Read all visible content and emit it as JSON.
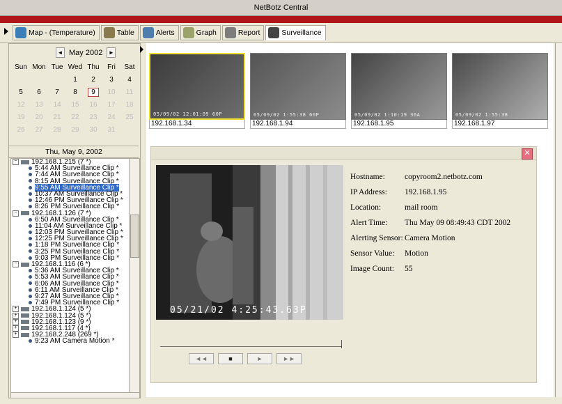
{
  "window": {
    "title": "NetBotz Central"
  },
  "tabs": [
    {
      "label": "Map - (Temperature)",
      "icon": "globe-icon",
      "color": "#3c7fb8",
      "active": false
    },
    {
      "label": "Table",
      "icon": "table-icon",
      "color": "#8a7a50",
      "active": false
    },
    {
      "label": "Alerts",
      "icon": "alert-icon",
      "color": "#4f7dae",
      "active": false
    },
    {
      "label": "Graph",
      "icon": "graph-icon",
      "color": "#9aa36a",
      "active": false
    },
    {
      "label": "Report",
      "icon": "report-icon",
      "color": "#7d7d7d",
      "active": false
    },
    {
      "label": "Surveillance",
      "icon": "camera-icon",
      "color": "#444444",
      "active": true
    }
  ],
  "calendar": {
    "prev": "◄",
    "month": "May",
    "year": "2002",
    "next": "►",
    "days": [
      "Sun",
      "Mon",
      "Tue",
      "Wed",
      "Thu",
      "Fri",
      "Sat"
    ],
    "weeks": [
      [
        "",
        "",
        "",
        "1",
        "2",
        "3",
        "4"
      ],
      [
        "5",
        "6",
        "7",
        "8",
        "9",
        "10",
        "11"
      ],
      [
        "12",
        "13",
        "14",
        "15",
        "16",
        "17",
        "18"
      ],
      [
        "19",
        "20",
        "21",
        "22",
        "23",
        "24",
        "25"
      ],
      [
        "26",
        "27",
        "28",
        "29",
        "30",
        "31",
        ""
      ]
    ],
    "selected_date": "Thu, May 9, 2002"
  },
  "tree": [
    {
      "type": "group",
      "label": "192.168.1.215 (7 *)"
    },
    {
      "type": "clip",
      "label": "5:44 AM Surveillance Clip *"
    },
    {
      "type": "clip",
      "label": "7:44 AM Surveillance Clip *"
    },
    {
      "type": "clip",
      "label": "8:15 AM Surveillance Clip *"
    },
    {
      "type": "clip",
      "label": "9:55 AM Surveillance Clip *",
      "selected": true
    },
    {
      "type": "clip",
      "label": "10:37 AM Surveillance Clip *"
    },
    {
      "type": "clip",
      "label": "12:46 PM Surveillance Clip *"
    },
    {
      "type": "clip",
      "label": "8:26 PM Surveillance Clip *"
    },
    {
      "type": "group",
      "label": "192.168.1.126 (7 *)"
    },
    {
      "type": "clip",
      "label": "6:50 AM Surveillance Clip *"
    },
    {
      "type": "clip",
      "label": "11:04 AM Surveillance Clip *"
    },
    {
      "type": "clip",
      "label": "12:03 PM Surveillance Clip *"
    },
    {
      "type": "clip",
      "label": "12:25 PM Surveillance Clip *"
    },
    {
      "type": "clip",
      "label": "1:18 PM Surveillance Clip *"
    },
    {
      "type": "clip",
      "label": "3:25 PM Surveillance Clip *"
    },
    {
      "type": "clip",
      "label": "9:03 PM Surveillance Clip *"
    },
    {
      "type": "group",
      "label": "192.168.1.116 (6 *)"
    },
    {
      "type": "clip",
      "label": "5:36 AM Surveillance Clip *"
    },
    {
      "type": "clip",
      "label": "5:53 AM Surveillance Clip *"
    },
    {
      "type": "clip",
      "label": "6:06 AM Surveillance Clip *"
    },
    {
      "type": "clip",
      "label": "6:11 AM Surveillance Clip *"
    },
    {
      "type": "clip",
      "label": "9:27 AM Surveillance Clip *"
    },
    {
      "type": "clip",
      "label": "7:49 PM Surveillance Clip *"
    },
    {
      "type": "group",
      "label": "192.168.1.124 (5 *)",
      "collapsed": true
    },
    {
      "type": "group",
      "label": "192.168.1.124 (5 *)",
      "collapsed": true
    },
    {
      "type": "group",
      "label": "192.168.1.123 (9 *)",
      "collapsed": true
    },
    {
      "type": "group",
      "label": "192.168.1.117 (4 *)",
      "collapsed": true
    },
    {
      "type": "group",
      "label": "192.168.2.248 (269 *)",
      "collapsed": true
    },
    {
      "type": "clip",
      "label": "9:23 AM Camera Motion *"
    }
  ],
  "thumbnails": [
    {
      "label": "192.168.1.34",
      "stamp": "05/09/02 12:01:09 60P",
      "active": true
    },
    {
      "label": "192.168.1.94",
      "stamp": "05/09/02 1:55:38 60P",
      "active": false
    },
    {
      "label": "192.168.1.95",
      "stamp": "05/09/02 1:10:19 36A",
      "active": false
    },
    {
      "label": "192.168.1.97",
      "stamp": "05/09/02 1:55:38",
      "active": false
    }
  ],
  "detail": {
    "close": "✕",
    "video_stamp": "05/21/02 4:25:43.63P",
    "fields": [
      {
        "key": "Hostname:",
        "value": "copyroom2.netbotz.com"
      },
      {
        "key": "IP Address:",
        "value": "192.168.1.95"
      },
      {
        "key": "Location:",
        "value": "mail room"
      },
      {
        "key": "Alert Time:",
        "value": "Thu May 09 08:49:43 CDT 2002"
      },
      {
        "key": "Alerting Sensor:",
        "value": "Camera Motion"
      },
      {
        "key": "Sensor Value:",
        "value": "Motion"
      },
      {
        "key": "Image Count:",
        "value": "55"
      }
    ],
    "controls": {
      "rewind": "◄◄",
      "stop": "■",
      "play": "►",
      "forward": "►►"
    }
  }
}
